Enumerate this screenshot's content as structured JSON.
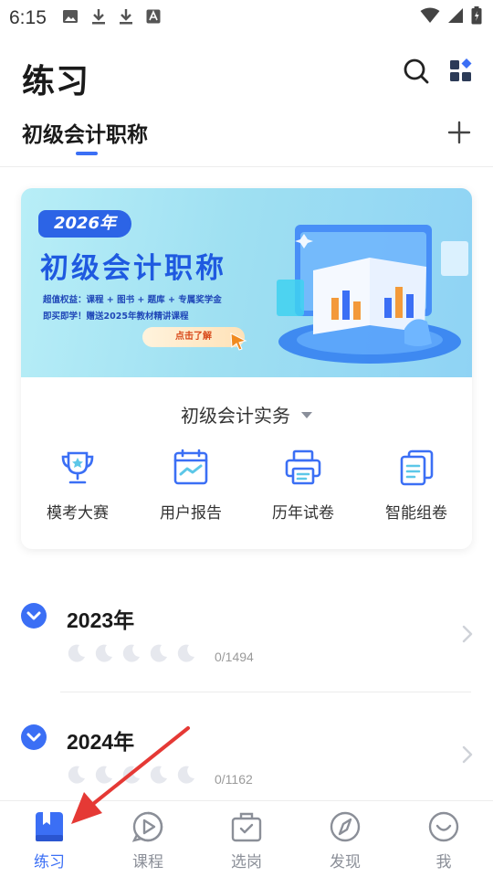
{
  "status_bar": {
    "time": "6:15",
    "left_icons": [
      "image-icon",
      "download-icon",
      "download-icon",
      "font-icon"
    ],
    "right_icons": [
      "wifi-icon",
      "signal-icon",
      "battery-icon"
    ]
  },
  "header": {
    "title": "练习",
    "search_icon": "search-icon",
    "grid_icon": "apps-grid-icon"
  },
  "subject": {
    "active_tab": "初级会计职称",
    "add_icon": "plus-icon"
  },
  "banner": {
    "year_badge": "2026年",
    "title": "初级会计职称",
    "line1": "超值权益：课程 + 图书 + 题库 + 专属奖学金",
    "line2": "即买即学！赠送2025年教材精讲课程",
    "cta": "点击了解"
  },
  "course_selector": {
    "selected": "初级会计实务"
  },
  "tools": [
    {
      "label": "模考大赛",
      "icon": "trophy-icon"
    },
    {
      "label": "用户报告",
      "icon": "report-icon"
    },
    {
      "label": "历年试卷",
      "icon": "printer-icon"
    },
    {
      "label": "智能组卷",
      "icon": "paper-stack-icon"
    }
  ],
  "years": [
    {
      "title": "2023年",
      "progress": "0/1494",
      "moons": 5
    },
    {
      "title": "2024年",
      "progress": "0/1162",
      "moons": 5
    }
  ],
  "bottom_nav": [
    {
      "label": "练习",
      "icon": "practice-book-icon",
      "active": true
    },
    {
      "label": "课程",
      "icon": "course-play-icon",
      "active": false
    },
    {
      "label": "选岗",
      "icon": "job-briefcase-icon",
      "active": false
    },
    {
      "label": "发现",
      "icon": "compass-icon",
      "active": false
    },
    {
      "label": "我",
      "icon": "profile-smile-icon",
      "active": false
    }
  ],
  "colors": {
    "accent": "#3b6ff5",
    "annotation": "#e53935",
    "banner_title": "#1f5ae0"
  }
}
